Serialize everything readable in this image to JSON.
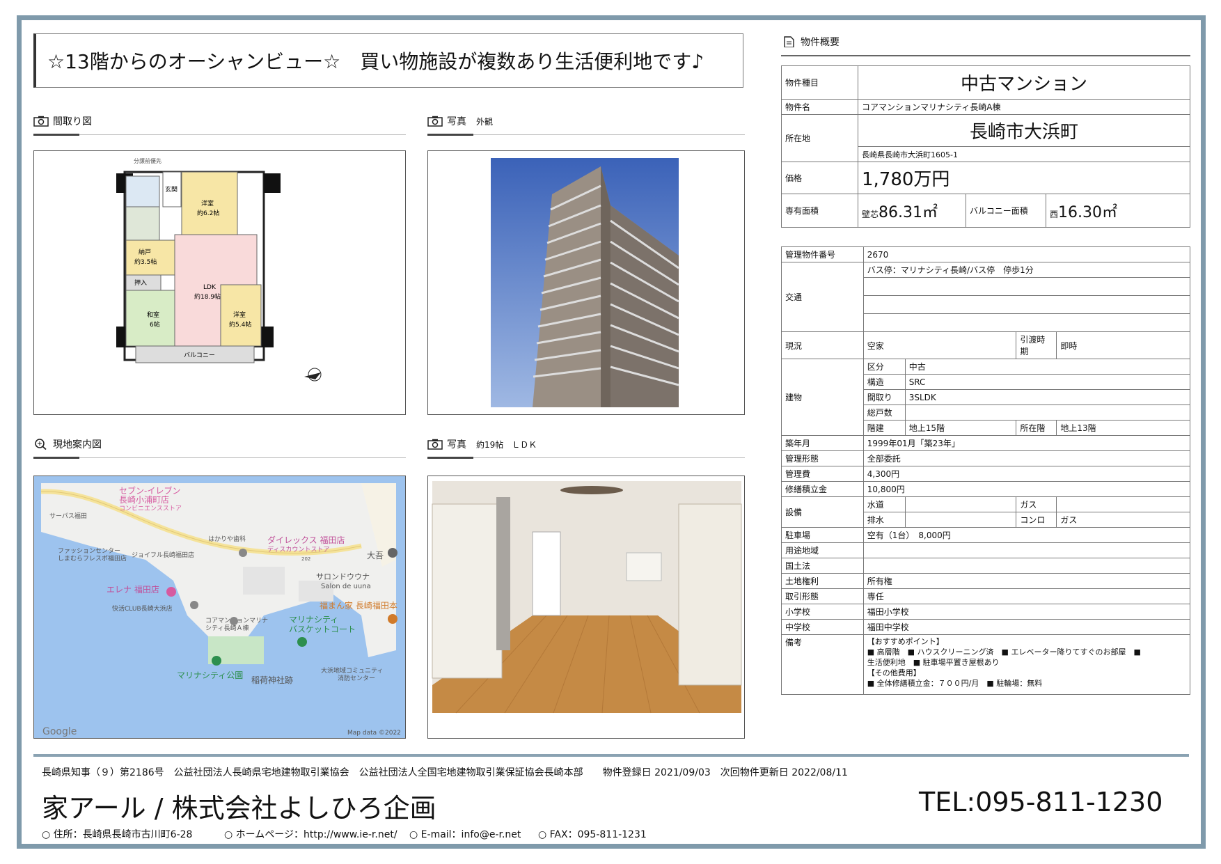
{
  "headline": "☆13階からのオーシャンビュー☆　買い物施設が複数あり生活便利地です♪",
  "sections": {
    "floorplan": "間取り図",
    "photo1_title": "写真",
    "photo1_caption": "外観",
    "map": "現地案内図",
    "photo2_title": "写真",
    "photo2_caption": "約19帖　ＬＤＫ",
    "overview": "物件概要"
  },
  "floorplan_labels": {
    "top": "分譲前優先",
    "entrance": "玄関",
    "west1": "洋室",
    "west1_size": "約6.2帖",
    "storage": "納戸",
    "storage_size": "約3.5帖",
    "closet": "押入",
    "ldk": "LDK",
    "ldk_size": "約18.9帖",
    "washitsu": "和室",
    "washitsu_size": "6帖",
    "west2": "洋室",
    "west2_size": "約5.4帖",
    "balcony": "バルコニー"
  },
  "map_labels": {
    "l1": "セブン-イレブン",
    "l2": "長崎小浦町店",
    "l3": "コンビニエンスストア",
    "l4": "サーパス福田",
    "l5": "はかりや歯科",
    "l6": "ダイレックス 福田店",
    "l7": "ディスカウントストア",
    "l8": "ファッションセンター",
    "l9": "しまむらフレスポ福田店",
    "l10": "ジョイフル長崎福田店",
    "l11": "大吾",
    "l12": "サロンドウウナ",
    "l13": "Salon de uuna",
    "l14": "エレナ 福田店",
    "l15": "快活CLUB長崎大浜店",
    "l16": "福まん家 長崎福田本",
    "l17": "コアマンションマリナ",
    "l18": "シティ長崎Ａ棟",
    "l19": "マリナシティ",
    "l20": "バスケットコート",
    "l21": "マリナシティ公園",
    "l22": "稲荷神社跡",
    "l23": "大浜地域コミュニティ",
    "l24": "消防センター",
    "google": "Google",
    "mapdata": "Map data ©2022",
    "road": "202"
  },
  "property": {
    "type_label": "物件種目",
    "type": "中古マンション",
    "name_label": "物件名",
    "name": "コアマンションマリナシティ長崎A棟",
    "loc_label": "所在地",
    "loc_big": "長崎市大浜町",
    "loc_full": "長崎県長崎市大浜町1605-1",
    "price_label": "価格",
    "price": "1,780万円",
    "area_label": "専有面積",
    "area_prefix": "壁芯",
    "area": "86.31㎡",
    "balcony_label": "バルコニー面積",
    "balcony_prefix": "西",
    "balcony": "16.30㎡"
  },
  "details": {
    "id_label": "管理物件番号",
    "id": "2670",
    "traffic_label": "交通",
    "traffic": "バス停：マリナシティ長崎/バス停　停歩1分",
    "status_label": "現況",
    "status": "空家",
    "handover_label": "引渡時期",
    "handover": "即時",
    "building_label": "建物",
    "kubun_label": "区分",
    "kubun": "中古",
    "kozo_label": "構造",
    "kozo": "SRC",
    "madori_label": "間取り",
    "madori": "3SLDK",
    "soko_label": "総戸数",
    "soko": "",
    "kaidate_label": "階建",
    "kaidate": "地上15階",
    "shozai_label": "所在階",
    "shozai": "地上13階",
    "built_label": "築年月",
    "built": "1999年01月「築23年」",
    "mgmt_label": "管理形態",
    "mgmt": "全部委託",
    "fee_label": "管理費",
    "fee": "4,300円",
    "repair_label": "修繕積立金",
    "repair": "10,800円",
    "equip_label": "設備",
    "water_label": "水道",
    "water": "",
    "gas_label": "ガス",
    "gas": "",
    "drain_label": "排水",
    "drain": "",
    "stove_label": "コンロ",
    "stove": "ガス",
    "parking_label": "駐車場",
    "parking": "空有（1台）　8,000円",
    "zoning_label": "用途地域",
    "zoning": "",
    "landlaw_label": "国土法",
    "landlaw": "",
    "landright_label": "土地権利",
    "landright": "所有権",
    "deal_label": "取引形態",
    "deal": "専任",
    "elem_label": "小学校",
    "elem": "福田小学校",
    "junior_label": "中学校",
    "junior": "福田中学校",
    "remarks_label": "備考",
    "remarks_1": "【おすすめポイント】",
    "remarks_2": "■ 高層階　■ ハウスクリーニング済　■ エレベーター降りてすぐのお部屋　■",
    "remarks_3": "生活便利地　■ 駐車場平置き屋根あり",
    "remarks_4": "【その他費用】",
    "remarks_5": "■ 全体修繕積立金：７００円/月　■ 駐輪場：無料"
  },
  "footer": {
    "license": "長崎県知事（９）第2186号　公益社団法人長崎県宅地建物取引業協会　公益社団法人全国宅地建物取引業保証協会長崎本部　　物件登録日 2021/09/03　次回物件更新日 2022/08/11",
    "company": "家アール / 株式会社よしひろ企画",
    "tel": "TEL:095-811-1230",
    "address": "○ 住所：長崎県長崎市古川町6-28",
    "homepage": "○ ホームページ：http://www.ie-r.net/",
    "email": "○ E-mail：info@e-r.net",
    "fax": "○ FAX：095-811-1231"
  },
  "colors": {
    "frame": "#7f9aab",
    "sea": "#9dc3ee",
    "road": "#f5e39a"
  }
}
